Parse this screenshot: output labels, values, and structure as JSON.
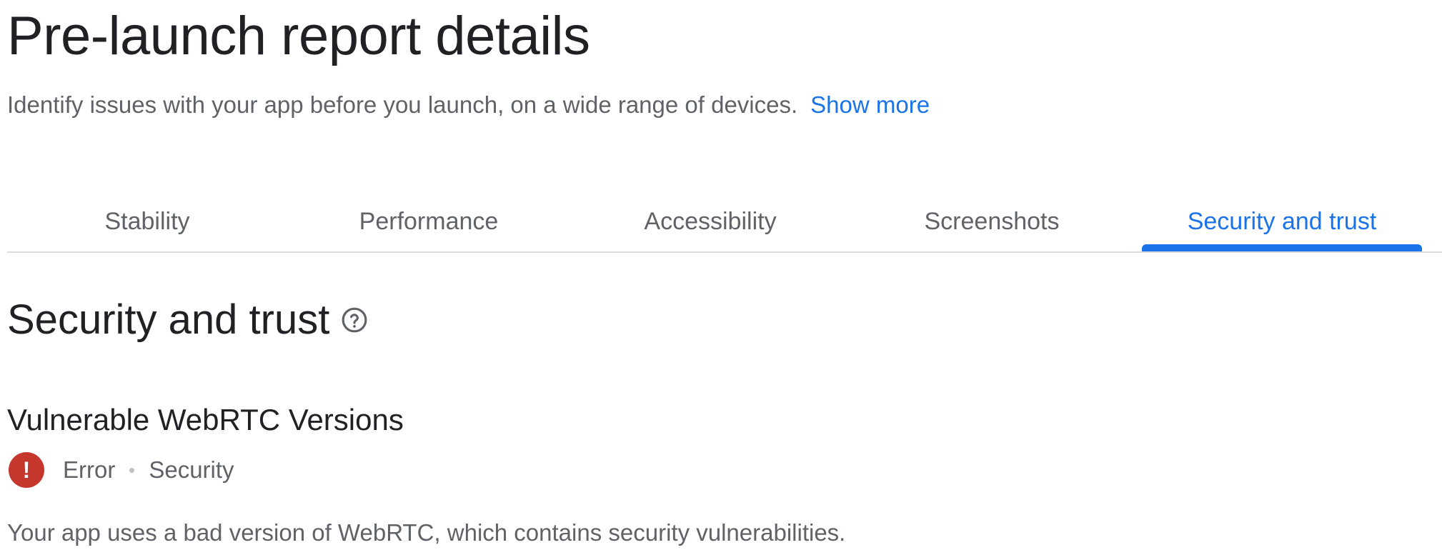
{
  "header": {
    "title": "Pre-launch report details",
    "subtitle": "Identify issues with your app before you launch, on a wide range of devices.",
    "show_more": "Show more"
  },
  "tabs": [
    {
      "label": "Stability",
      "active": false
    },
    {
      "label": "Performance",
      "active": false
    },
    {
      "label": "Accessibility",
      "active": false
    },
    {
      "label": "Screenshots",
      "active": false
    },
    {
      "label": "Security and trust",
      "active": true
    }
  ],
  "section": {
    "title": "Security and trust",
    "help_icon": "help-circle-icon"
  },
  "issue": {
    "title": "Vulnerable WebRTC Versions",
    "severity_icon": "error-icon",
    "severity": "Error",
    "category": "Security",
    "description": "Your app uses a bad version of WebRTC, which contains security vulnerabilities."
  },
  "colors": {
    "accent": "#1a73e8",
    "error": "#c5372c",
    "text_primary": "#202124",
    "text_secondary": "#5f6368",
    "divider": "#dadce0"
  }
}
